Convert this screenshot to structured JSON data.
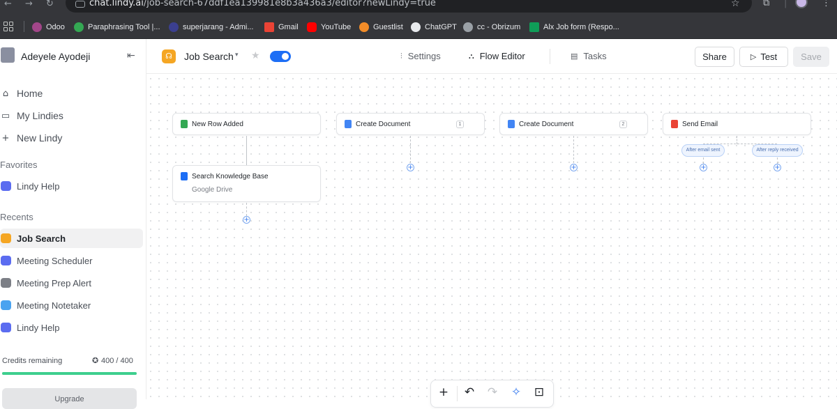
{
  "browser": {
    "url_domain": "chat.lindy.ai",
    "url_path": "/job-search-67ddf1ea139981e8b3a436a3/editor?newLindy=true",
    "bookmarks": [
      {
        "label": "Odoo",
        "color": "#a24689"
      },
      {
        "label": "Paraphrasing Tool |...",
        "color": "#34a853"
      },
      {
        "label": "superjarang - Admi...",
        "color": "#3b3f8f"
      },
      {
        "label": "Gmail",
        "color": "#ea4335"
      },
      {
        "label": "YouTube",
        "color": "#ff0000"
      },
      {
        "label": "Guestlist",
        "color": "#f28c28"
      },
      {
        "label": "ChatGPT",
        "color": "#e8eaed"
      },
      {
        "label": "cc - Obrizum",
        "color": "#9aa0a6"
      },
      {
        "label": "Alx Job form (Respo...",
        "color": "#0f9d58"
      }
    ]
  },
  "sidebar": {
    "user_name": "Adeyele Ayodeji",
    "links": [
      {
        "label": "Home",
        "icon": "home-icon",
        "glyph": "⌂"
      },
      {
        "label": "My Lindies",
        "icon": "folder-icon",
        "glyph": "▭"
      },
      {
        "label": "New Lindy",
        "icon": "plus-icon",
        "glyph": "+"
      }
    ],
    "favorites_heading": "Favorites",
    "favorites": [
      {
        "label": "Lindy Help",
        "color": "#5b6cf0"
      }
    ],
    "recents_heading": "Recents",
    "recents": [
      {
        "label": "Job Search",
        "color": "#f5a623"
      },
      {
        "label": "Meeting Scheduler",
        "color": "#5b6cf0"
      },
      {
        "label": "Meeting Prep Alert",
        "color": "#7c7f86"
      },
      {
        "label": "Meeting Notetaker",
        "color": "#4aa3f0"
      },
      {
        "label": "Lindy Help",
        "color": "#5b6cf0"
      }
    ],
    "credits_label": "Credits remaining",
    "credits_value": "400 / 400",
    "credits_fraction": 1.0,
    "upgrade_label": "Upgrade"
  },
  "topbar": {
    "agent_name": "Job Search",
    "toggle_on": true,
    "tabs": [
      {
        "label": "Settings",
        "glyph": "⫶",
        "active": false
      },
      {
        "label": "Flow Editor",
        "glyph": "⛬",
        "active": true
      },
      {
        "label": "Tasks",
        "glyph": "▤",
        "active": false
      }
    ],
    "share_label": "Share",
    "test_label": "Test",
    "save_label": "Save"
  },
  "flow": {
    "nodes": [
      {
        "title": "New Row Added",
        "icon_color": "#34a853",
        "badge": ""
      },
      {
        "title": "Create Document",
        "icon_color": "#4285f4",
        "badge": "1"
      },
      {
        "title": "Create Document",
        "icon_color": "#4285f4",
        "badge": "2"
      },
      {
        "title": "Send Email",
        "icon_color": "#ea4335",
        "badge": ""
      },
      {
        "title": "Search Knowledge Base",
        "subtitle": "Google Drive",
        "icon_color": "#1d6ef5",
        "badge": ""
      }
    ],
    "branches": [
      "After email sent",
      "After reply received"
    ]
  },
  "toolbar": {
    "add": "+",
    "undo": "↶",
    "redo": "↷",
    "auto_layout": "✧",
    "fit_view": "⊡"
  }
}
